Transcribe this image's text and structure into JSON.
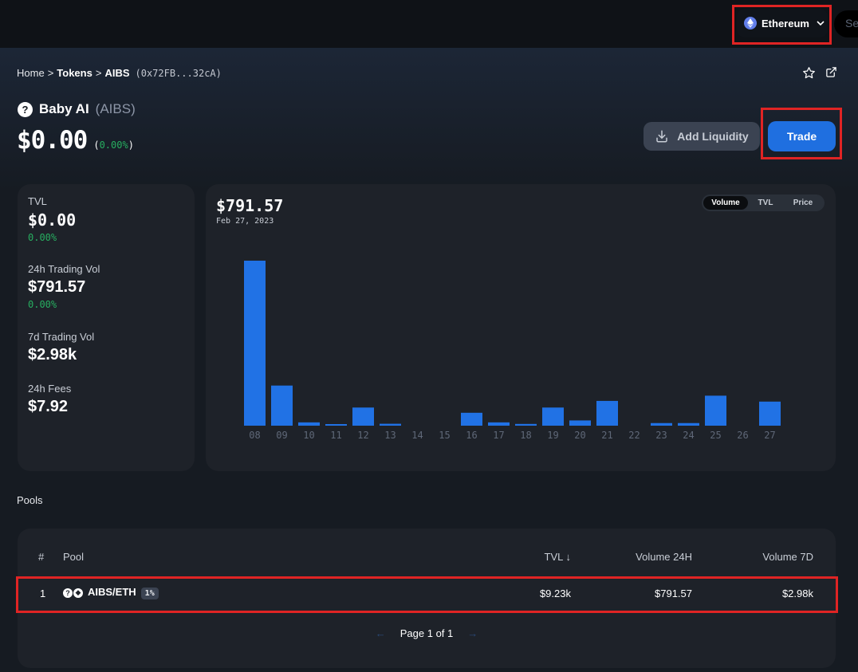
{
  "network": {
    "label": "Ethereum",
    "icon": "ethereum-icon"
  },
  "search": {
    "placeholder": "Se"
  },
  "breadcrumb": {
    "home": "Home",
    "sep": ">",
    "tokens": "Tokens",
    "symbol": "AIBS",
    "address": "(0x72FB...32cA)"
  },
  "token": {
    "name": "Baby AI",
    "symbol": "(AIBS)",
    "price": "$0.00",
    "change_open": "(",
    "change": "0.00%",
    "change_close": ")"
  },
  "actions": {
    "add_liquidity": "Add Liquidity",
    "trade": "Trade"
  },
  "stats": [
    {
      "label": "TVL",
      "value": "$0.00",
      "change": "0.00%"
    },
    {
      "label": "24h Trading Vol",
      "value": "$791.57",
      "change": "0.00%"
    },
    {
      "label": "7d Trading Vol",
      "value": "$2.98k"
    },
    {
      "label": "24h Fees",
      "value": "$7.92"
    }
  ],
  "chart": {
    "value": "$791.57",
    "date": "Feb 27, 2023",
    "toggles": [
      "Volume",
      "TVL",
      "Price"
    ],
    "active_toggle": "Volume"
  },
  "chart_data": {
    "type": "bar",
    "categories": [
      "08",
      "09",
      "10",
      "11",
      "12",
      "13",
      "14",
      "15",
      "16",
      "17",
      "18",
      "19",
      "20",
      "21",
      "22",
      "23",
      "24",
      "25",
      "26",
      "27"
    ],
    "values": [
      4730,
      1150,
      95,
      45,
      520,
      55,
      0,
      0,
      370,
      95,
      50,
      520,
      150,
      710,
      0,
      75,
      75,
      860,
      0,
      690
    ],
    "color": "#2172e5"
  },
  "pools": {
    "title": "Pools",
    "headers": {
      "index": "#",
      "pool": "Pool",
      "tvl": "TVL ↓",
      "vol24": "Volume 24H",
      "vol7": "Volume 7D"
    },
    "rows": [
      {
        "index": "1",
        "pair": "AIBS/ETH",
        "fee": "1%",
        "tvl": "$9.23k",
        "vol24": "$791.57",
        "vol7": "$2.98k"
      }
    ],
    "pagination": {
      "prev": "←",
      "label": "Page 1 of 1",
      "next": "→"
    }
  },
  "colors": {
    "accent": "#1f6fe0",
    "positive": "#27ae60",
    "highlight": "#e02424"
  }
}
